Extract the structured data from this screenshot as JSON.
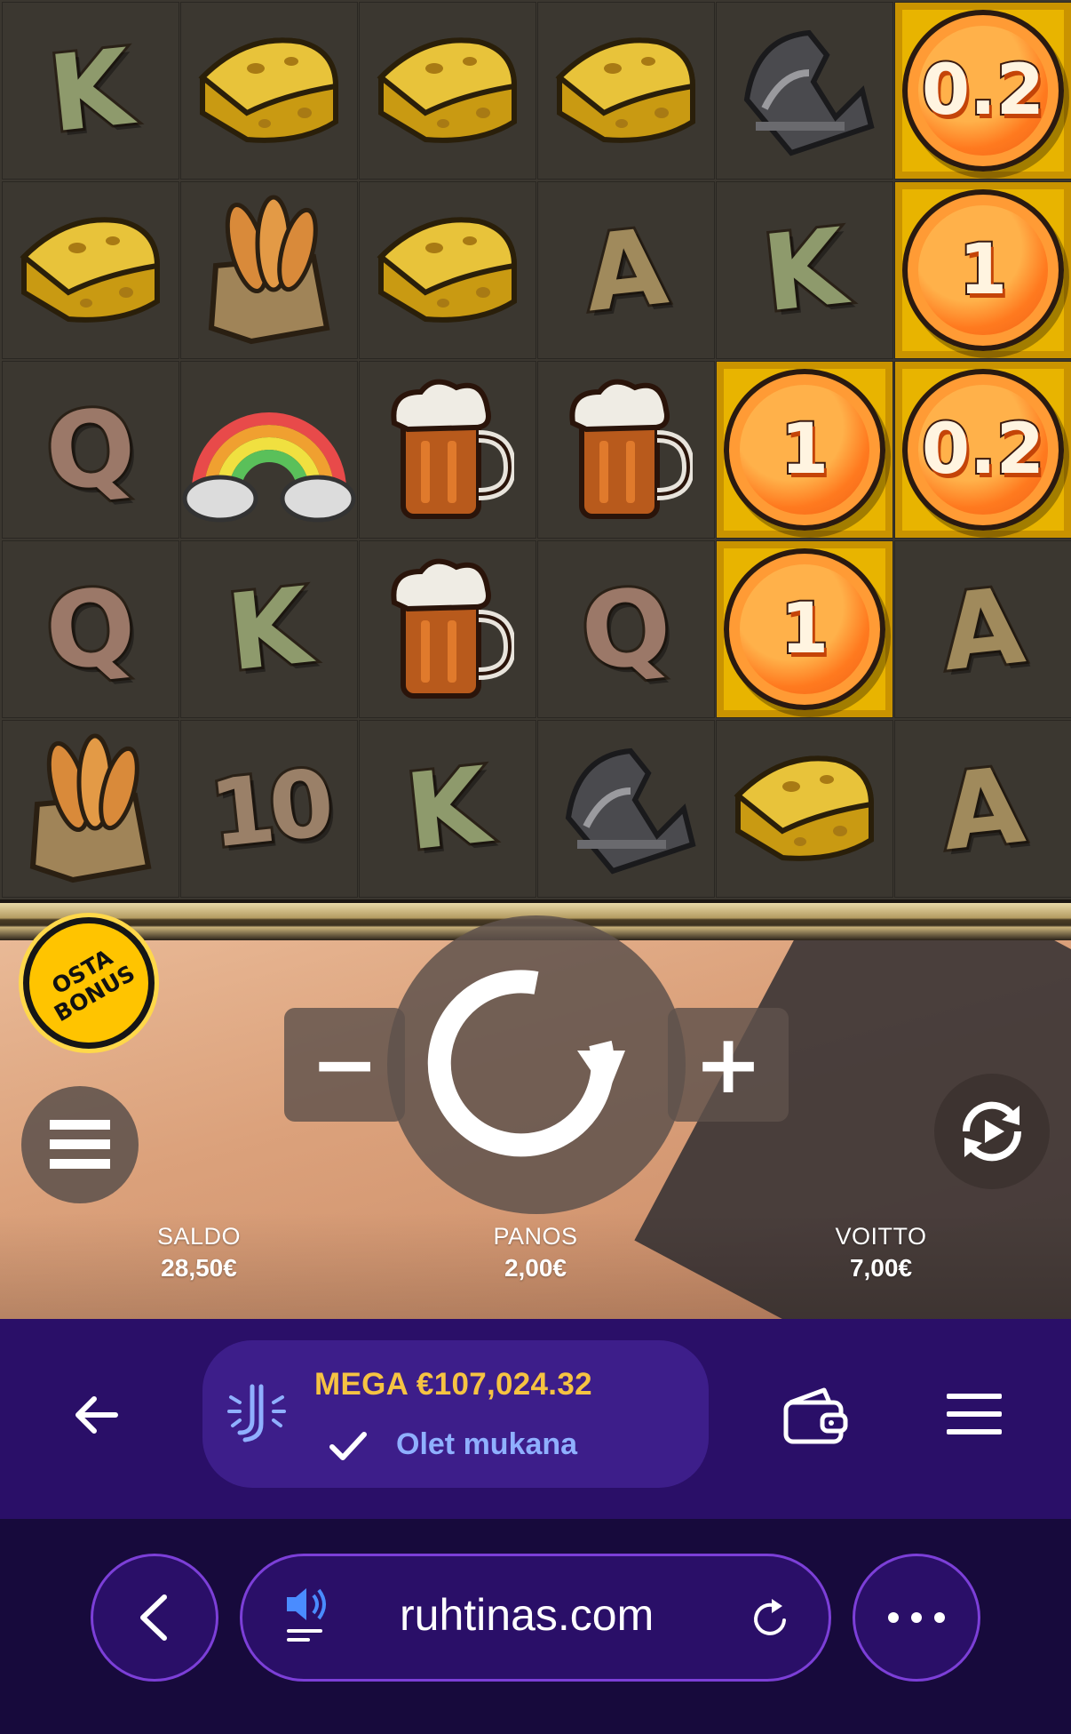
{
  "grid": {
    "columns": 6,
    "rows": [
      [
        {
          "type": "letter",
          "label": "K"
        },
        {
          "type": "cheese"
        },
        {
          "type": "cheese"
        },
        {
          "type": "cheese"
        },
        {
          "type": "trap"
        },
        {
          "type": "coin",
          "label": "0.2"
        }
      ],
      [
        {
          "type": "cheese"
        },
        {
          "type": "bread"
        },
        {
          "type": "cheese"
        },
        {
          "type": "letter",
          "label": "A"
        },
        {
          "type": "letter",
          "label": "K"
        },
        {
          "type": "coin",
          "label": "1"
        }
      ],
      [
        {
          "type": "letter",
          "label": "Q"
        },
        {
          "type": "rainbow"
        },
        {
          "type": "beer"
        },
        {
          "type": "beer"
        },
        {
          "type": "coin",
          "label": "1"
        },
        {
          "type": "coin",
          "label": "0.2"
        }
      ],
      [
        {
          "type": "letter",
          "label": "Q"
        },
        {
          "type": "letter",
          "label": "K"
        },
        {
          "type": "beer"
        },
        {
          "type": "letter",
          "label": "Q"
        },
        {
          "type": "coin",
          "label": "1"
        },
        {
          "type": "letter",
          "label": "A"
        }
      ],
      [
        {
          "type": "bread"
        },
        {
          "type": "letter",
          "label": "10"
        },
        {
          "type": "letter",
          "label": "K"
        },
        {
          "type": "trap"
        },
        {
          "type": "cheese"
        },
        {
          "type": "letter",
          "label": "A"
        }
      ]
    ]
  },
  "controls": {
    "bonus_line1": "OSTA",
    "bonus_line2": "BONUS",
    "minus": "−",
    "plus": "+"
  },
  "stats": {
    "balance_label": "SALDO",
    "balance_value": "28,50€",
    "bet_label": "PANOS",
    "bet_value": "2,00€",
    "win_label": "VOITTO",
    "win_value": "7,00€"
  },
  "casino_bar": {
    "jackpot_text": "MEGA €107,024.32",
    "joined_text": "Olet mukana"
  },
  "browser": {
    "url": "ruhtinas.com"
  },
  "colors": {
    "jackpot_amount": "#f6c342",
    "joined": "#8fb0ff",
    "casino_bar_bg": "#2a0f68",
    "highlight_cell": "#e8b400"
  }
}
